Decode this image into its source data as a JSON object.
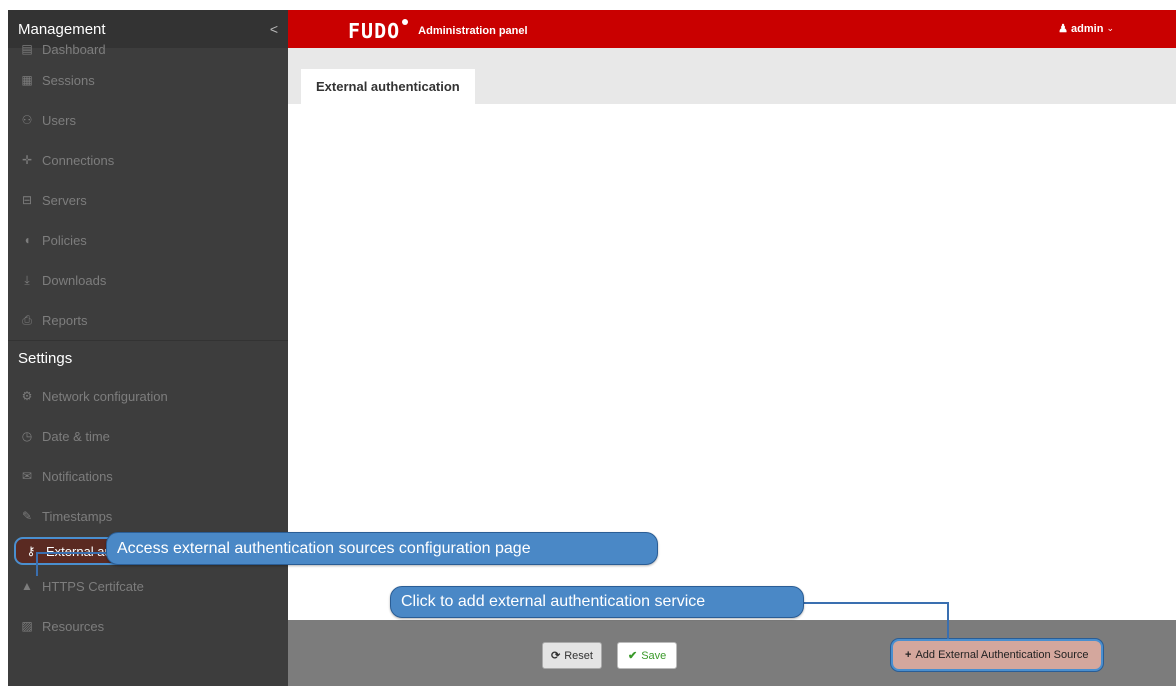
{
  "header": {
    "logo_text": "FUDO",
    "panel_title": "Administration panel",
    "user_name": "admin",
    "user_icon": "user-icon",
    "user_chevron": "⌄",
    "brand_color": "#c90000"
  },
  "sidebar": {
    "management_title": "Management",
    "collapse_glyph": "<",
    "management_items": [
      {
        "label": "Dashboard",
        "icon": "dashboard-icon",
        "glyph": "▤"
      },
      {
        "label": "Sessions",
        "icon": "film-icon",
        "glyph": "▦"
      },
      {
        "label": "Users",
        "icon": "users-icon",
        "glyph": "⚇"
      },
      {
        "label": "Connections",
        "icon": "move-icon",
        "glyph": "✛"
      },
      {
        "label": "Servers",
        "icon": "server-icon",
        "glyph": "⊟"
      },
      {
        "label": "Policies",
        "icon": "shield-icon",
        "glyph": "◖"
      },
      {
        "label": "Downloads",
        "icon": "download-icon",
        "glyph": "⤓"
      },
      {
        "label": "Reports",
        "icon": "print-icon",
        "glyph": "⎙"
      }
    ],
    "settings_title": "Settings",
    "settings_items": [
      {
        "label": "Network configuration",
        "icon": "cogs-icon",
        "glyph": "⚙"
      },
      {
        "label": "Date & time",
        "icon": "clock-icon",
        "glyph": "◷"
      },
      {
        "label": "Notifications",
        "icon": "envelope-icon",
        "glyph": "✉"
      },
      {
        "label": "Timestamps",
        "icon": "edit-icon",
        "glyph": "✎"
      },
      {
        "label": "External authentication",
        "icon": "key-icon",
        "glyph": "⚷"
      },
      {
        "label": "HTTPS Certifcate",
        "icon": "lock-icon",
        "glyph": "▲"
      },
      {
        "label": "Resources",
        "icon": "picture-icon",
        "glyph": "▨"
      }
    ],
    "active_item": "External authentication"
  },
  "main": {
    "tab_label": "External authentication"
  },
  "footer": {
    "reset_label": "Reset",
    "reset_icon": "refresh-icon",
    "reset_glyph": "⟳",
    "save_label": "Save",
    "save_icon": "check-icon",
    "save_glyph": "✔",
    "add_label": "Add External Authentication Source",
    "add_icon": "plus-icon",
    "add_glyph": "+"
  },
  "callouts": {
    "external_auth": "Access external authentication sources configuration page",
    "add_service": "Click to add external authentication service"
  }
}
